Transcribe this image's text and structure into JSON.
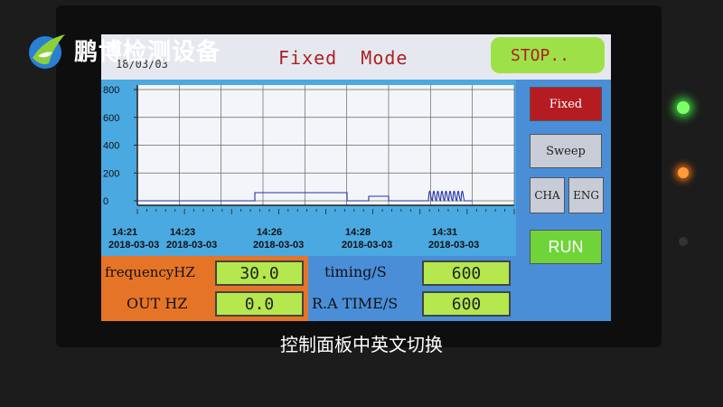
{
  "watermark": {
    "brand_text": "鹏博检测设备"
  },
  "header": {
    "date": "18/03/03",
    "mode_title": "Fixed  Mode",
    "stop_label": "STOP.."
  },
  "chart_data": {
    "type": "line",
    "y_ticks": [
      "800",
      "600",
      "400",
      "200",
      "0"
    ],
    "ylim": [
      0,
      800
    ],
    "grid": true,
    "x_ticks": [
      {
        "time": "14:21",
        "date": "2018-03-03"
      },
      {
        "time": "14:23",
        "date": "2018-03-03"
      },
      {
        "time": "14:26",
        "date": "2018-03-03"
      },
      {
        "time": "14:28",
        "date": "2018-03-03"
      },
      {
        "time": "14:31",
        "date": "2018-03-03"
      }
    ],
    "color": "#2233aa"
  },
  "side_buttons": {
    "fixed": "Fixed",
    "sweep": "Sweep",
    "cha": "CHA",
    "eng": "ENG",
    "run": "RUN"
  },
  "params": {
    "frequency_label": "frequencyHZ",
    "frequency_value": "30.0",
    "out_label": "OUT HZ",
    "out_value": "0.0",
    "timing_label": "timing/S",
    "timing_value": "600",
    "ra_time_label": "R.A TIME/S",
    "ra_time_value": "600"
  },
  "caption": "控制面板中英文切换"
}
